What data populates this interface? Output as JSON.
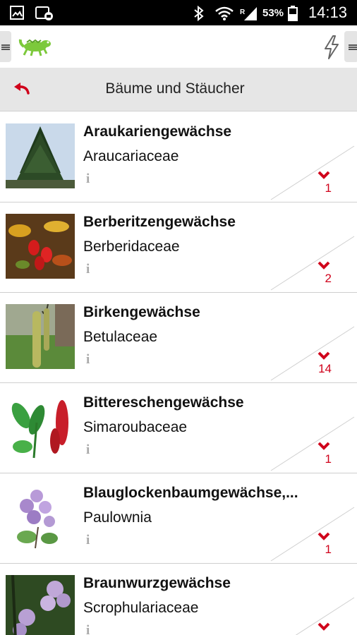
{
  "status_bar": {
    "battery_percent": "53%",
    "time": "14:13",
    "icons": [
      "gallery-icon",
      "app-notification-icon",
      "bluetooth-icon",
      "wifi-icon",
      "signal-icon",
      "battery-icon"
    ]
  },
  "app_bar": {
    "logo": "green-lizard-logo",
    "left_menu_icon": "hamburger-icon",
    "right_action_icon": "lightning-icon",
    "right_menu_icon": "hamburger-icon"
  },
  "sub_header": {
    "title": "Bäume und Stäucher",
    "back_icon": "back-arrow-icon"
  },
  "colors": {
    "accent": "#d0021b",
    "header_bg": "#e6e6e6",
    "logo_green": "#7cc93b"
  },
  "families": [
    {
      "name": "Araukariengewächse",
      "latin": "Araucariaceae",
      "info": "i",
      "count": "1",
      "thumb": "araucaria-tree"
    },
    {
      "name": "Berberitzengewächse",
      "latin": "Berberidaceae",
      "info": "i",
      "count": "2",
      "thumb": "red-berries"
    },
    {
      "name": "Birkengewächse",
      "latin": "Betulaceae",
      "info": "i",
      "count": "14",
      "thumb": "birch-catkins"
    },
    {
      "name": "Bittereschengewächse",
      "latin": "Simaroubaceae",
      "info": "i",
      "count": "1",
      "thumb": "red-flower-spike"
    },
    {
      "name": "Blauglockenbaumgewächse,...",
      "latin": "Paulownia",
      "info": "i",
      "count": "1",
      "thumb": "purple-blossoms"
    },
    {
      "name": "Braunwurzgewächse",
      "latin": "Scrophulariaceae",
      "info": "i",
      "count": "",
      "thumb": "lilac-blossoms"
    }
  ]
}
